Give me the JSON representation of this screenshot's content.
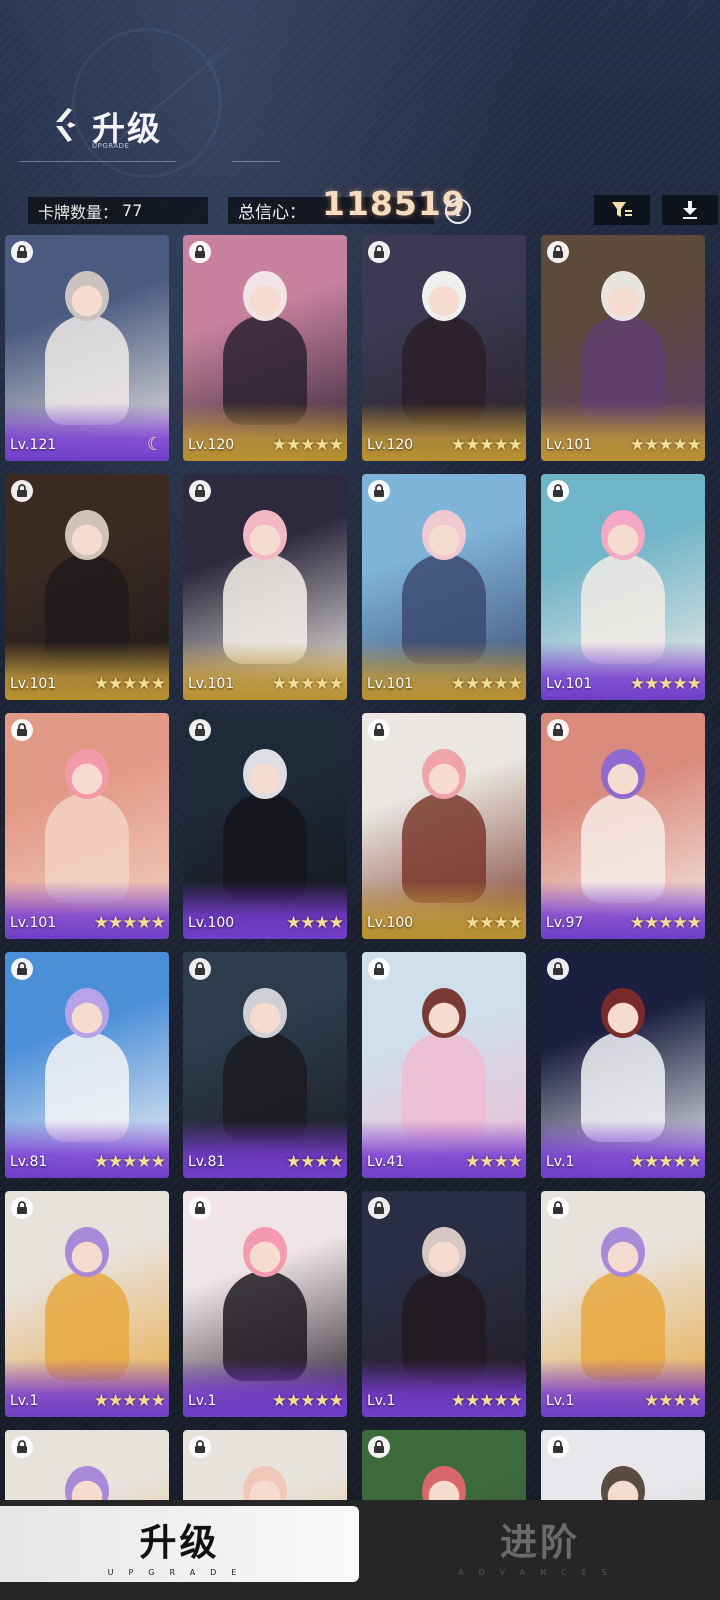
{
  "header": {
    "title": "升级",
    "subtitle": "UPGRADE"
  },
  "stats": {
    "card_count_label": "卡牌数量：",
    "card_count": "77",
    "confidence_label": "总信心：",
    "confidence_value": "118519",
    "info_icon": "i"
  },
  "toolbar": {
    "filter_icon": "filter-icon",
    "download_icon": "download-icon"
  },
  "cards": [
    {
      "level": "Lv.121",
      "stars": "",
      "rank_icon": "☾",
      "frame": "purple",
      "palette": [
        "#4a5a80",
        "#c9c2bd",
        "#eeeae6"
      ]
    },
    {
      "level": "Lv.120",
      "stars": "★★★★★",
      "frame": "gold",
      "palette": [
        "#c9829e",
        "#f1e3e6",
        "#2b2230"
      ]
    },
    {
      "level": "Lv.120",
      "stars": "★★★★★",
      "frame": "gold",
      "palette": [
        "#3b3a52",
        "#efefef",
        "#2a2028"
      ]
    },
    {
      "level": "Lv.101",
      "stars": "★★★★★",
      "frame": "gold",
      "palette": [
        "#5c4a3a",
        "#e8e4e0",
        "#5e3f6e"
      ]
    },
    {
      "level": "Lv.101",
      "stars": "★★★★★",
      "frame": "gold",
      "palette": [
        "#3a2a22",
        "#cfc3b8",
        "#1e1a1c"
      ]
    },
    {
      "level": "Lv.101",
      "stars": "★★★★★",
      "frame": "gold",
      "palette": [
        "#2e2a3e",
        "#f3b8c4",
        "#f4f0ea"
      ]
    },
    {
      "level": "Lv.101",
      "stars": "★★★★★",
      "frame": "gold",
      "palette": [
        "#7fb3d8",
        "#f0c8d0",
        "#3c4a70"
      ]
    },
    {
      "level": "Lv.101",
      "stars": "★★★★★",
      "frame": "purple",
      "palette": [
        "#6fb4c8",
        "#f4a8c4",
        "#f3ece6"
      ]
    },
    {
      "level": "Lv.101",
      "stars": "★★★★★",
      "frame": "purple",
      "palette": [
        "#e29a86",
        "#f39aa8",
        "#f3d2c4"
      ]
    },
    {
      "level": "Lv.100",
      "stars": "★★★★",
      "frame": "purple",
      "palette": [
        "#1f2a38",
        "#dfdde4",
        "#15141a"
      ]
    },
    {
      "level": "Lv.100",
      "stars": "★★★★",
      "frame": "gold",
      "palette": [
        "#eae6e2",
        "#f0a3a8",
        "#7a3a2c"
      ]
    },
    {
      "level": "Lv.97",
      "stars": "★★★★★",
      "frame": "purple",
      "palette": [
        "#d98a7c",
        "#8c6ad0",
        "#f6ece6"
      ]
    },
    {
      "level": "Lv.81",
      "stars": "★★★★★",
      "frame": "purple",
      "palette": [
        "#4b8fd8",
        "#b8a2e8",
        "#f6f4f4"
      ]
    },
    {
      "level": "Lv.81",
      "stars": "★★★★",
      "frame": "purple",
      "palette": [
        "#2c3c4c",
        "#cfcfd4",
        "#1b1b20"
      ]
    },
    {
      "level": "Lv.41",
      "stars": "★★★★",
      "frame": "purple",
      "palette": [
        "#cfe0ec",
        "#7a3a34",
        "#f0bcd0"
      ]
    },
    {
      "level": "Lv.1",
      "stars": "★★★★★",
      "frame": "purple",
      "palette": [
        "#1c2040",
        "#7a2a2a",
        "#f2f2f6"
      ]
    },
    {
      "level": "Lv.1",
      "stars": "★★★★★",
      "frame": "purple",
      "palette": [
        "#e8e2dc",
        "#a88ad8",
        "#e8a840"
      ]
    },
    {
      "level": "Lv.1",
      "stars": "★★★★★",
      "frame": "purple",
      "palette": [
        "#f0e4e6",
        "#f39ab0",
        "#1e1a22"
      ]
    },
    {
      "level": "Lv.1",
      "stars": "★★★★★",
      "frame": "purple",
      "palette": [
        "#2a2e44",
        "#d8c8c4",
        "#221a1e"
      ]
    },
    {
      "level": "Lv.1",
      "stars": "★★★★",
      "frame": "purple",
      "palette": [
        "#e8e2dc",
        "#a88ad8",
        "#e8a840"
      ]
    },
    {
      "level": "",
      "stars": "",
      "frame": "purple",
      "palette": [
        "#e8e2dc",
        "#a88ad8",
        "#e8a840"
      ]
    },
    {
      "level": "",
      "stars": "",
      "frame": "purple",
      "palette": [
        "#e8e2dc",
        "#f0c8b8",
        "#e8a840"
      ]
    },
    {
      "level": "",
      "stars": "",
      "frame": "purple",
      "palette": [
        "#3d6a3a",
        "#d8686c",
        "#4a3a4c"
      ]
    },
    {
      "level": "",
      "stars": "",
      "frame": "purple",
      "palette": [
        "#e8e8ec",
        "#5a4a40",
        "#c0b8b0"
      ]
    }
  ],
  "tabs": [
    {
      "label": "升级",
      "sub": "UPGRADE",
      "active": true
    },
    {
      "label": "进阶",
      "sub": "ADVANCES",
      "active": false
    }
  ]
}
